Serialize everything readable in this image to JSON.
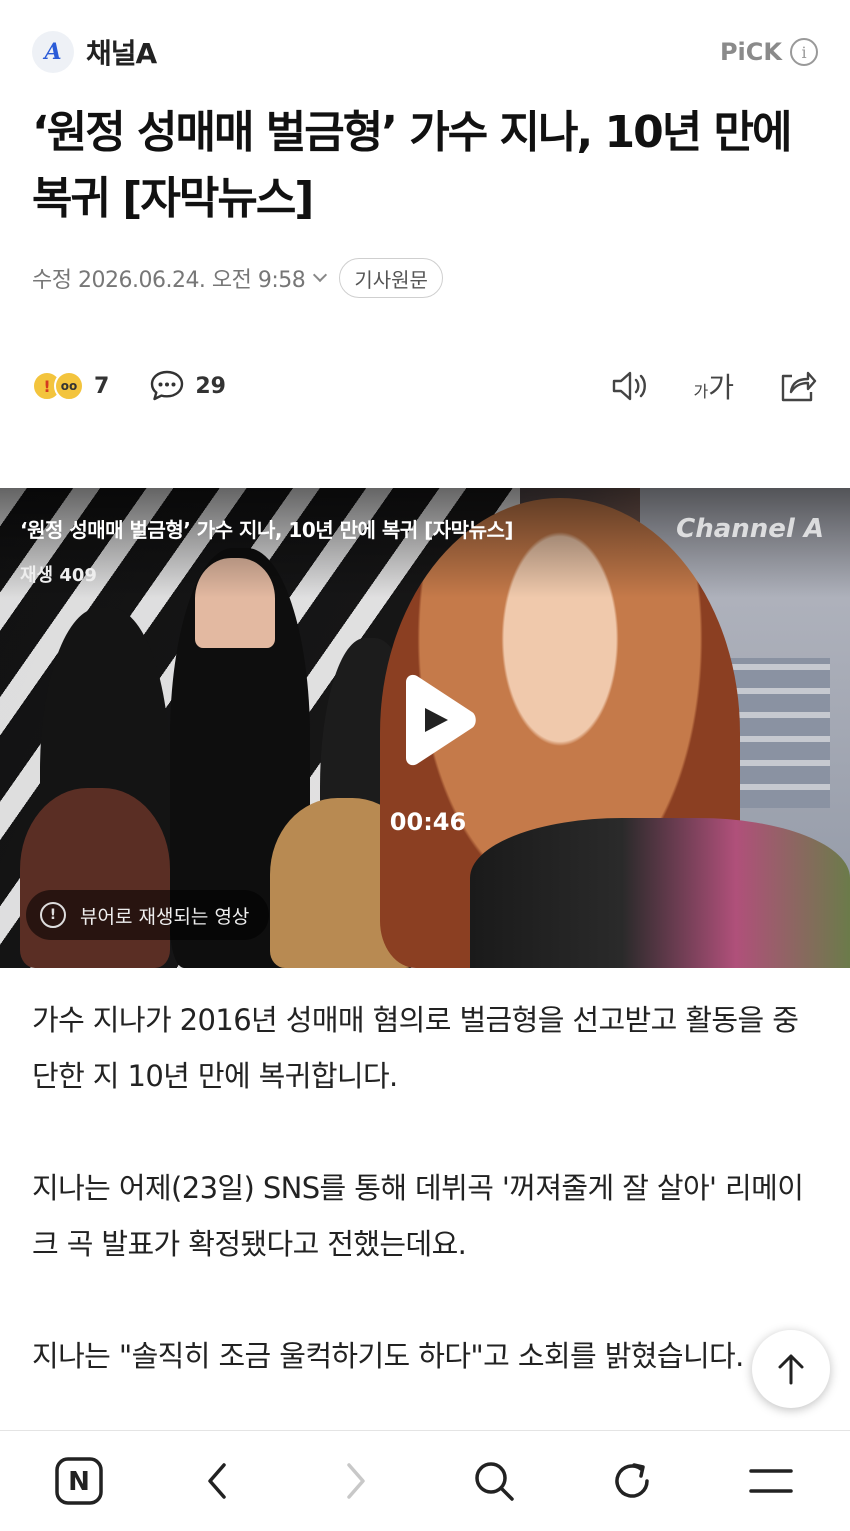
{
  "header": {
    "press_logo_letter": "A",
    "press_name": "채널A",
    "pick_label": "PiCK",
    "info_glyph": "i"
  },
  "headline": "‘원정 성매매 벌금형’ 가수 지나, 10년 만에 복귀 [자막뉴스]",
  "meta": {
    "date": "수정 2026.06.24. 오전 9:58",
    "original_button": "기사원문"
  },
  "actions": {
    "reaction_count": "7",
    "comment_count": "29",
    "font_size_small": "가",
    "font_size_large": "가",
    "icons": [
      "reaction-emoji-icon",
      "comment-icon",
      "speaker-icon",
      "font-size-icon",
      "share-icon"
    ]
  },
  "video": {
    "title": "‘원정 성매매 벌금형’ 가수 지나, 10년 만에 복귀 [자막뉴스]",
    "channel_watermark": "Channel A",
    "views": "재생 409",
    "duration": "00:46",
    "notice": "뷰어로 재생되는 영상",
    "notice_glyph": "!"
  },
  "article": {
    "paragraphs": [
      "가수 지나가 2016년 성매매 혐의로 벌금형을 선고받고 활동을 중단한 지 10년 만에 복귀합니다.",
      "지나는 어제(23일) SNS를 통해 데뷔곡 '꺼져줄게 잘 살아' 리메이크 곡 발표가 확정됐다고 전했는데요.",
      "지나는 \"솔직히 조금 울컥하기도 하다\"고 소회를 밝혔습니다."
    ]
  },
  "bottom_nav": {
    "items": [
      "naver-home-icon",
      "back-icon",
      "forward-icon",
      "search-icon",
      "refresh-icon",
      "menu-icon"
    ],
    "home_letter": "N"
  },
  "colors": {
    "accent_blue": "#2a5bd7",
    "text_dark": "#111111",
    "text_muted": "#777777",
    "reaction_yellow": "#f3c43d"
  }
}
